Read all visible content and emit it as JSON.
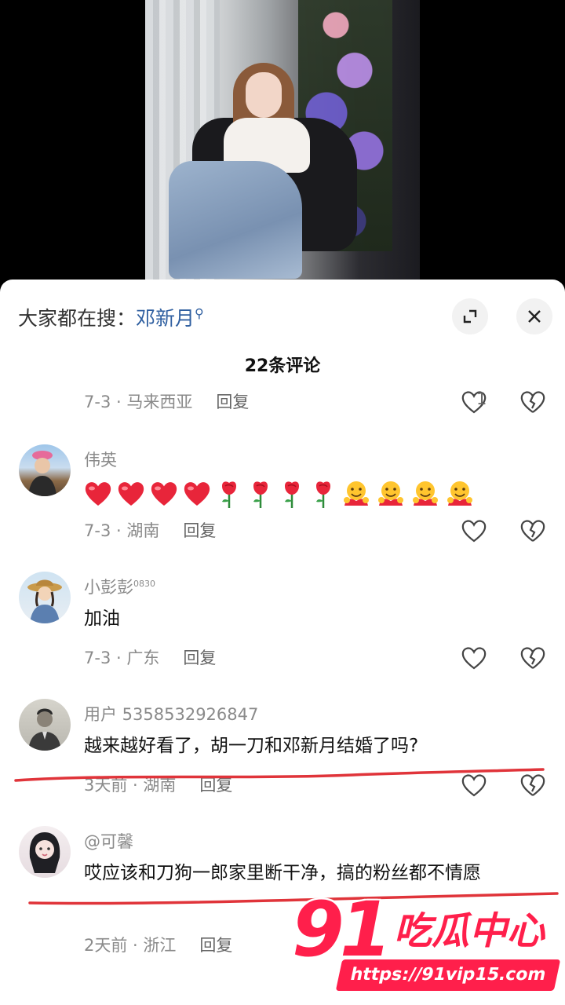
{
  "search_bar": {
    "prefix": "大家都在搜：",
    "keyword": "邓新月"
  },
  "comment_count_title": "22条评论",
  "comments": [
    {
      "username": "",
      "content": "",
      "meta": "7-3 · 马来西亚",
      "reply": "回复",
      "likes": "1"
    },
    {
      "username": "伟英",
      "emoji": [
        "red-heart",
        "red-heart",
        "red-heart",
        "red-heart",
        "rose",
        "rose",
        "rose",
        "rose",
        "hugging-face",
        "hugging-face",
        "hugging-face",
        "hugging-face"
      ],
      "meta": "7-3 · 湖南",
      "reply": "回复"
    },
    {
      "username": "小彭彭",
      "username_sup": "0830",
      "content": "加油",
      "meta": "7-3 · 广东",
      "reply": "回复"
    },
    {
      "username": "用户 5358532926847",
      "content": "越来越好看了，胡一刀和邓新月结婚了吗?",
      "meta": "3天前 · 湖南",
      "reply": "回复"
    },
    {
      "username": "@可馨",
      "content": "哎应该和刀狗一郎家里断干净，搞的粉丝都不情愿",
      "meta": "2天前 · 浙江",
      "reply": "回复"
    }
  ],
  "watermark": {
    "number": "91",
    "text": "吃瓜中心",
    "url": "https://91vip15.com"
  },
  "colors": {
    "keyword": "#2f5fa0",
    "meta": "#8a8a8a",
    "underline": "#e0343a",
    "watermark": "#ff1f4b"
  }
}
